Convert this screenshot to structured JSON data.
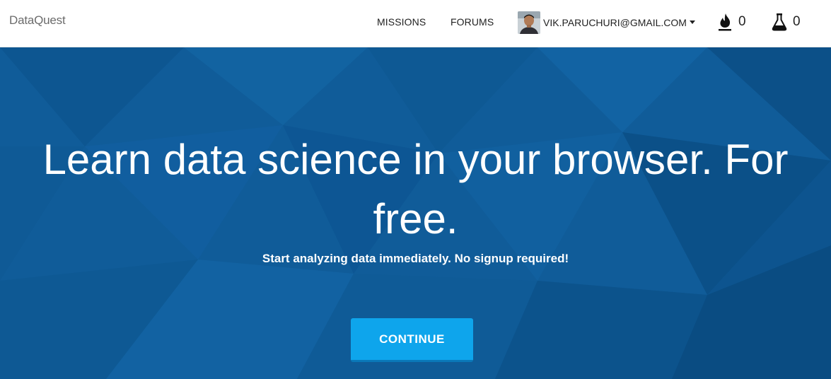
{
  "nav": {
    "brand": "DataQuest",
    "links": {
      "missions": "MISSIONS",
      "forums": "FORUMS"
    },
    "user": {
      "email": "VIK.PARUCHURI@GMAIL.COM"
    },
    "stats": {
      "streak_icon": "flame-icon",
      "streak_count": "0",
      "labs_icon": "flask-icon",
      "labs_count": "0"
    }
  },
  "hero": {
    "title": "Learn data science in your browser. For free.",
    "subtitle": "Start analyzing data immediately. No signup required!",
    "cta_label": "CONTINUE"
  },
  "colors": {
    "hero_background": "#0f5a97",
    "cta_background": "#0ea5ec",
    "nav_background": "#ffffff"
  }
}
